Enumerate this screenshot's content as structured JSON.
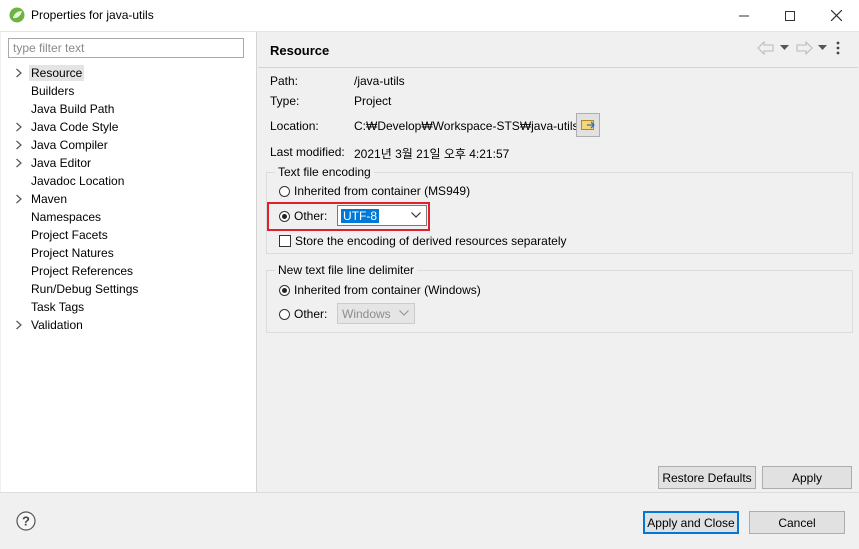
{
  "window": {
    "title": "Properties for java-utils",
    "icon": "spring-leaf-icon",
    "controls": [
      "minimize-icon",
      "maximize-icon",
      "close-icon"
    ]
  },
  "filter": {
    "placeholder": "type filter text",
    "value": ""
  },
  "tree": {
    "items": [
      {
        "label": "Resource",
        "expandable": true,
        "selected": true
      },
      {
        "label": "Builders",
        "expandable": false
      },
      {
        "label": "Java Build Path",
        "expandable": false
      },
      {
        "label": "Java Code Style",
        "expandable": true
      },
      {
        "label": "Java Compiler",
        "expandable": true
      },
      {
        "label": "Java Editor",
        "expandable": true
      },
      {
        "label": "Javadoc Location",
        "expandable": false
      },
      {
        "label": "Maven",
        "expandable": true
      },
      {
        "label": "Namespaces",
        "expandable": false
      },
      {
        "label": "Project Facets",
        "expandable": false
      },
      {
        "label": "Project Natures",
        "expandable": false
      },
      {
        "label": "Project References",
        "expandable": false
      },
      {
        "label": "Run/Debug Settings",
        "expandable": false
      },
      {
        "label": "Task Tags",
        "expandable": false
      },
      {
        "label": "Validation",
        "expandable": true
      }
    ]
  },
  "page": {
    "title": "Resource",
    "fields": {
      "path_label": "Path:",
      "path_value": "/java-utils",
      "type_label": "Type:",
      "type_value": "Project",
      "location_label": "Location:",
      "location_value": "C:₩Develop₩Workspace-STS₩java-utils",
      "modified_label": "Last modified:",
      "modified_value": "2021년 3월 21일 오후 4:21:57"
    },
    "encoding": {
      "group_title": "Text file encoding",
      "inherited_label": "Inherited from container (MS949)",
      "other_label": "Other:",
      "other_value": "UTF-8",
      "selected": "other",
      "store_label": "Store the encoding of derived resources separately",
      "store_checked": false
    },
    "delimiter": {
      "group_title": "New text file line delimiter",
      "inherited_label": "Inherited from container (Windows)",
      "other_label": "Other:",
      "other_value": "Windows",
      "selected": "inherited"
    },
    "buttons": {
      "restore_defaults": "Restore Defaults",
      "apply": "Apply"
    }
  },
  "footer": {
    "apply_and_close": "Apply and Close",
    "cancel": "Cancel"
  },
  "colors": {
    "highlight": "#e0202d",
    "selection": "#0078d7"
  }
}
